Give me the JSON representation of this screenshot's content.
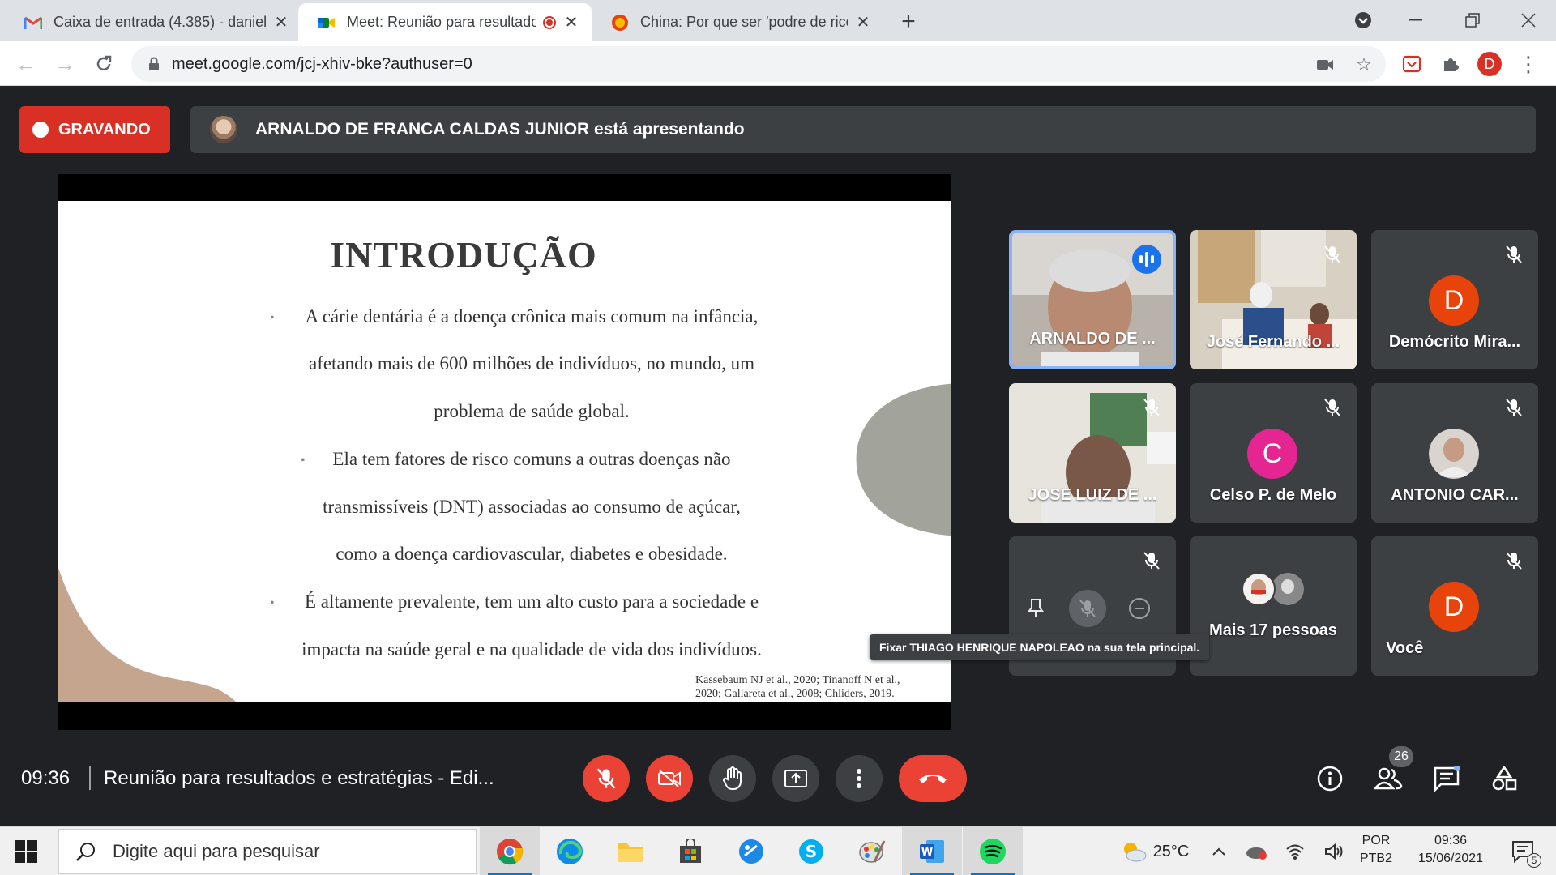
{
  "browser": {
    "tabs": [
      {
        "title": "Caixa de entrada (4.385) - daniel",
        "icon": "gmail-icon"
      },
      {
        "title": "Meet: Reunião para resultado",
        "icon": "meet-icon",
        "recording": true
      },
      {
        "title": "China: Por que ser 'podre de rico",
        "icon": "news-icon"
      }
    ],
    "url": "meet.google.com/jcj-xhiv-bke?authuser=0",
    "profile_initial": "D"
  },
  "meet": {
    "recording_label": "GRAVANDO",
    "presenter_text": "ARNALDO DE FRANCA CALDAS JUNIOR está apresentando",
    "slide": {
      "title": "INTRODUÇÃO",
      "lines": [
        "A cárie dentária é a doença crônica mais comum na infância,",
        "afetando mais de 600 milhões de indivíduos, no mundo, um",
        "problema de saúde global.",
        "Ela tem fatores de risco comuns a outras doenças não",
        "transmissíveis (DNT) associadas ao consumo de açúcar,",
        "como a doença cardiovascular, diabetes e obesidade.",
        "É altamente prevalente, tem um alto custo para a sociedade e",
        "impacta na saúde geral e na qualidade de vida dos indivíduos."
      ],
      "bullet": "•",
      "reference_1": "Kassebaum NJ et al., 2020; Tinanoff N et al.,",
      "reference_2": "2020; Gallareta et al., 2008; Chliders, 2019."
    },
    "participants": [
      {
        "name": "ARNALDO DE ...",
        "speaking": true
      },
      {
        "name": "José Fernando ...",
        "muted": true
      },
      {
        "name": "Demócrito Mira...",
        "initial": "D",
        "color": "#e8430b",
        "muted": true
      },
      {
        "name": "JOSE LUIZ DE ...",
        "muted": true
      },
      {
        "name": "Celso P. de Melo",
        "initial": "C",
        "color": "#e52592",
        "muted": true
      },
      {
        "name": "ANTONIO CAR...",
        "muted": true
      },
      {
        "name": "",
        "muted": true,
        "hover_controls": true
      },
      {
        "name": "Mais 17 pessoas"
      },
      {
        "name": "Você",
        "initial": "D",
        "color": "#e8430b",
        "muted": true
      }
    ],
    "tooltip": "Fixar THIAGO HENRIQUE NAPOLEAO na sua tela principal.",
    "time": "09:36",
    "meeting_title": "Reunião para resultados e estratégias - Edi...",
    "people_count": "26"
  },
  "taskbar": {
    "search_placeholder": "Digite aqui para pesquisar",
    "weather": "25°C",
    "lang_1": "POR",
    "lang_2": "PTB2",
    "time": "09:36",
    "date": "15/06/2021",
    "notifications": "5"
  }
}
